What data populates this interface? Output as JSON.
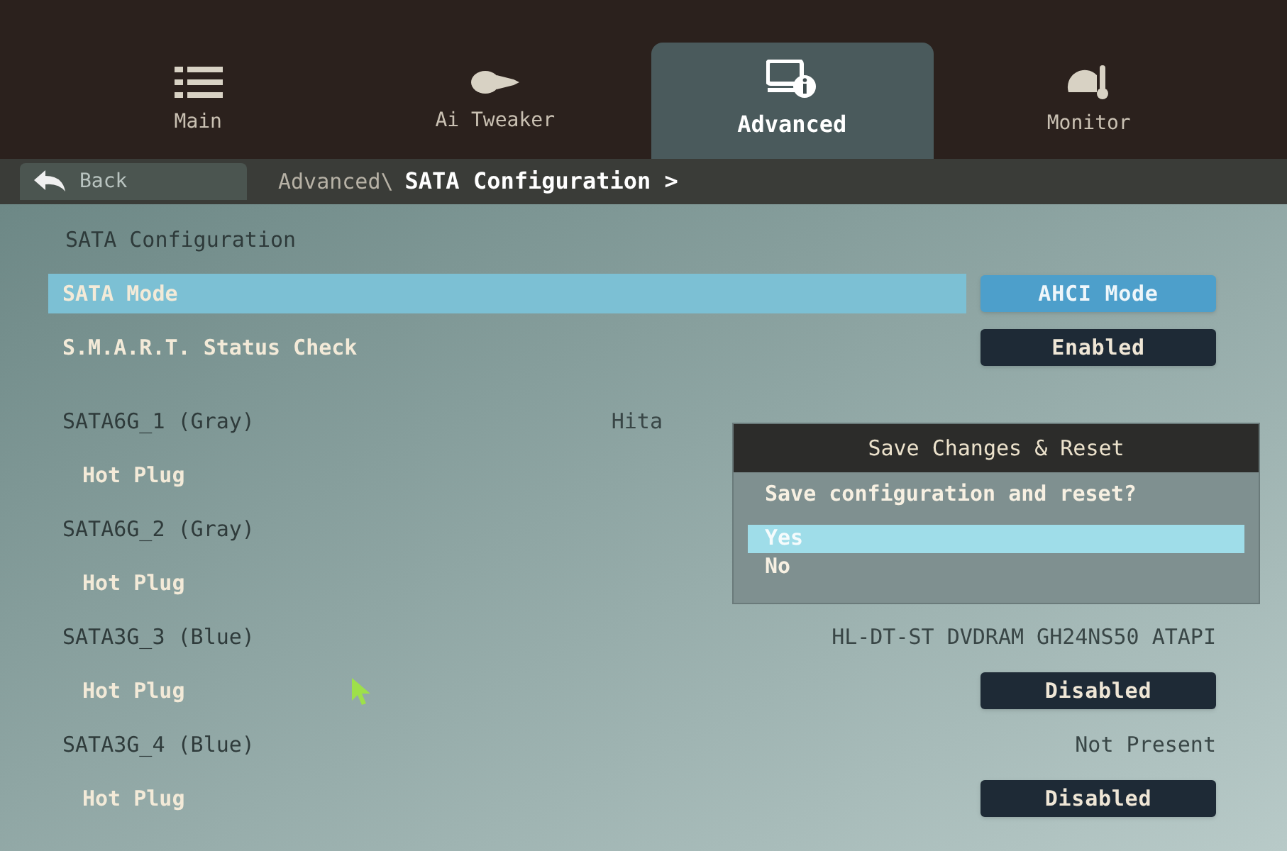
{
  "tabs": [
    {
      "label": "Main",
      "selected": false
    },
    {
      "label": "Ai Tweaker",
      "selected": false
    },
    {
      "label": "Advanced",
      "selected": true
    },
    {
      "label": "Monitor",
      "selected": false
    }
  ],
  "back": "Back",
  "breadcrumb": {
    "path": "Advanced\\",
    "current": "SATA Configuration >"
  },
  "items": [
    {
      "kind": "section",
      "label": "SATA Configuration"
    },
    {
      "kind": "option",
      "label": "SATA Mode",
      "value": "AHCI Mode",
      "selected": true
    },
    {
      "kind": "option",
      "label": "S.M.A.R.T. Status Check",
      "value": "Enabled",
      "selected": false
    },
    {
      "kind": "port",
      "label": "SATA6G_1 (Gray)",
      "device": "Hita"
    },
    {
      "kind": "option",
      "label": "Hot Plug",
      "selected": false
    },
    {
      "kind": "port",
      "label": "SATA6G_2 (Gray)"
    },
    {
      "kind": "option",
      "label": "Hot Plug",
      "selected": false
    },
    {
      "kind": "port",
      "label": "SATA3G_3 (Blue)",
      "device": "HL-DT-ST DVDRAM GH24NS50 ATAPI"
    },
    {
      "kind": "option",
      "label": "Hot Plug",
      "value": "Disabled",
      "selected": false
    },
    {
      "kind": "port",
      "label": "SATA3G_4 (Blue)",
      "device": "Not Present"
    },
    {
      "kind": "option",
      "label": "Hot Plug",
      "value": "Disabled",
      "selected": false
    }
  ],
  "dialog": {
    "title": "Save Changes & Reset",
    "message": "Save configuration and reset?",
    "options": [
      {
        "label": "Yes",
        "selected": true
      },
      {
        "label": "No",
        "selected": false
      }
    ]
  }
}
